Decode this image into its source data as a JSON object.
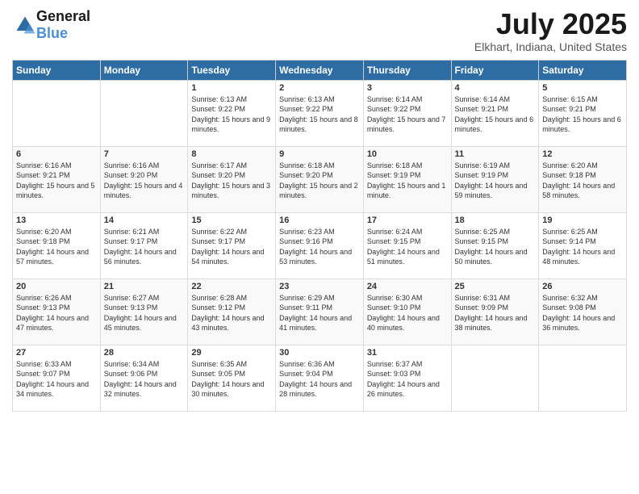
{
  "header": {
    "logo_general": "General",
    "logo_blue": "Blue",
    "month_year": "July 2025",
    "location": "Elkhart, Indiana, United States"
  },
  "weekdays": [
    "Sunday",
    "Monday",
    "Tuesday",
    "Wednesday",
    "Thursday",
    "Friday",
    "Saturday"
  ],
  "weeks": [
    [
      {
        "day": "",
        "sunrise": "",
        "sunset": "",
        "daylight": ""
      },
      {
        "day": "",
        "sunrise": "",
        "sunset": "",
        "daylight": ""
      },
      {
        "day": "1",
        "sunrise": "Sunrise: 6:13 AM",
        "sunset": "Sunset: 9:22 PM",
        "daylight": "Daylight: 15 hours and 9 minutes."
      },
      {
        "day": "2",
        "sunrise": "Sunrise: 6:13 AM",
        "sunset": "Sunset: 9:22 PM",
        "daylight": "Daylight: 15 hours and 8 minutes."
      },
      {
        "day": "3",
        "sunrise": "Sunrise: 6:14 AM",
        "sunset": "Sunset: 9:22 PM",
        "daylight": "Daylight: 15 hours and 7 minutes."
      },
      {
        "day": "4",
        "sunrise": "Sunrise: 6:14 AM",
        "sunset": "Sunset: 9:21 PM",
        "daylight": "Daylight: 15 hours and 6 minutes."
      },
      {
        "day": "5",
        "sunrise": "Sunrise: 6:15 AM",
        "sunset": "Sunset: 9:21 PM",
        "daylight": "Daylight: 15 hours and 6 minutes."
      }
    ],
    [
      {
        "day": "6",
        "sunrise": "Sunrise: 6:16 AM",
        "sunset": "Sunset: 9:21 PM",
        "daylight": "Daylight: 15 hours and 5 minutes."
      },
      {
        "day": "7",
        "sunrise": "Sunrise: 6:16 AM",
        "sunset": "Sunset: 9:20 PM",
        "daylight": "Daylight: 15 hours and 4 minutes."
      },
      {
        "day": "8",
        "sunrise": "Sunrise: 6:17 AM",
        "sunset": "Sunset: 9:20 PM",
        "daylight": "Daylight: 15 hours and 3 minutes."
      },
      {
        "day": "9",
        "sunrise": "Sunrise: 6:18 AM",
        "sunset": "Sunset: 9:20 PM",
        "daylight": "Daylight: 15 hours and 2 minutes."
      },
      {
        "day": "10",
        "sunrise": "Sunrise: 6:18 AM",
        "sunset": "Sunset: 9:19 PM",
        "daylight": "Daylight: 15 hours and 1 minute."
      },
      {
        "day": "11",
        "sunrise": "Sunrise: 6:19 AM",
        "sunset": "Sunset: 9:19 PM",
        "daylight": "Daylight: 14 hours and 59 minutes."
      },
      {
        "day": "12",
        "sunrise": "Sunrise: 6:20 AM",
        "sunset": "Sunset: 9:18 PM",
        "daylight": "Daylight: 14 hours and 58 minutes."
      }
    ],
    [
      {
        "day": "13",
        "sunrise": "Sunrise: 6:20 AM",
        "sunset": "Sunset: 9:18 PM",
        "daylight": "Daylight: 14 hours and 57 minutes."
      },
      {
        "day": "14",
        "sunrise": "Sunrise: 6:21 AM",
        "sunset": "Sunset: 9:17 PM",
        "daylight": "Daylight: 14 hours and 56 minutes."
      },
      {
        "day": "15",
        "sunrise": "Sunrise: 6:22 AM",
        "sunset": "Sunset: 9:17 PM",
        "daylight": "Daylight: 14 hours and 54 minutes."
      },
      {
        "day": "16",
        "sunrise": "Sunrise: 6:23 AM",
        "sunset": "Sunset: 9:16 PM",
        "daylight": "Daylight: 14 hours and 53 minutes."
      },
      {
        "day": "17",
        "sunrise": "Sunrise: 6:24 AM",
        "sunset": "Sunset: 9:15 PM",
        "daylight": "Daylight: 14 hours and 51 minutes."
      },
      {
        "day": "18",
        "sunrise": "Sunrise: 6:25 AM",
        "sunset": "Sunset: 9:15 PM",
        "daylight": "Daylight: 14 hours and 50 minutes."
      },
      {
        "day": "19",
        "sunrise": "Sunrise: 6:25 AM",
        "sunset": "Sunset: 9:14 PM",
        "daylight": "Daylight: 14 hours and 48 minutes."
      }
    ],
    [
      {
        "day": "20",
        "sunrise": "Sunrise: 6:26 AM",
        "sunset": "Sunset: 9:13 PM",
        "daylight": "Daylight: 14 hours and 47 minutes."
      },
      {
        "day": "21",
        "sunrise": "Sunrise: 6:27 AM",
        "sunset": "Sunset: 9:13 PM",
        "daylight": "Daylight: 14 hours and 45 minutes."
      },
      {
        "day": "22",
        "sunrise": "Sunrise: 6:28 AM",
        "sunset": "Sunset: 9:12 PM",
        "daylight": "Daylight: 14 hours and 43 minutes."
      },
      {
        "day": "23",
        "sunrise": "Sunrise: 6:29 AM",
        "sunset": "Sunset: 9:11 PM",
        "daylight": "Daylight: 14 hours and 41 minutes."
      },
      {
        "day": "24",
        "sunrise": "Sunrise: 6:30 AM",
        "sunset": "Sunset: 9:10 PM",
        "daylight": "Daylight: 14 hours and 40 minutes."
      },
      {
        "day": "25",
        "sunrise": "Sunrise: 6:31 AM",
        "sunset": "Sunset: 9:09 PM",
        "daylight": "Daylight: 14 hours and 38 minutes."
      },
      {
        "day": "26",
        "sunrise": "Sunrise: 6:32 AM",
        "sunset": "Sunset: 9:08 PM",
        "daylight": "Daylight: 14 hours and 36 minutes."
      }
    ],
    [
      {
        "day": "27",
        "sunrise": "Sunrise: 6:33 AM",
        "sunset": "Sunset: 9:07 PM",
        "daylight": "Daylight: 14 hours and 34 minutes."
      },
      {
        "day": "28",
        "sunrise": "Sunrise: 6:34 AM",
        "sunset": "Sunset: 9:06 PM",
        "daylight": "Daylight: 14 hours and 32 minutes."
      },
      {
        "day": "29",
        "sunrise": "Sunrise: 6:35 AM",
        "sunset": "Sunset: 9:05 PM",
        "daylight": "Daylight: 14 hours and 30 minutes."
      },
      {
        "day": "30",
        "sunrise": "Sunrise: 6:36 AM",
        "sunset": "Sunset: 9:04 PM",
        "daylight": "Daylight: 14 hours and 28 minutes."
      },
      {
        "day": "31",
        "sunrise": "Sunrise: 6:37 AM",
        "sunset": "Sunset: 9:03 PM",
        "daylight": "Daylight: 14 hours and 26 minutes."
      },
      {
        "day": "",
        "sunrise": "",
        "sunset": "",
        "daylight": ""
      },
      {
        "day": "",
        "sunrise": "",
        "sunset": "",
        "daylight": ""
      }
    ]
  ]
}
